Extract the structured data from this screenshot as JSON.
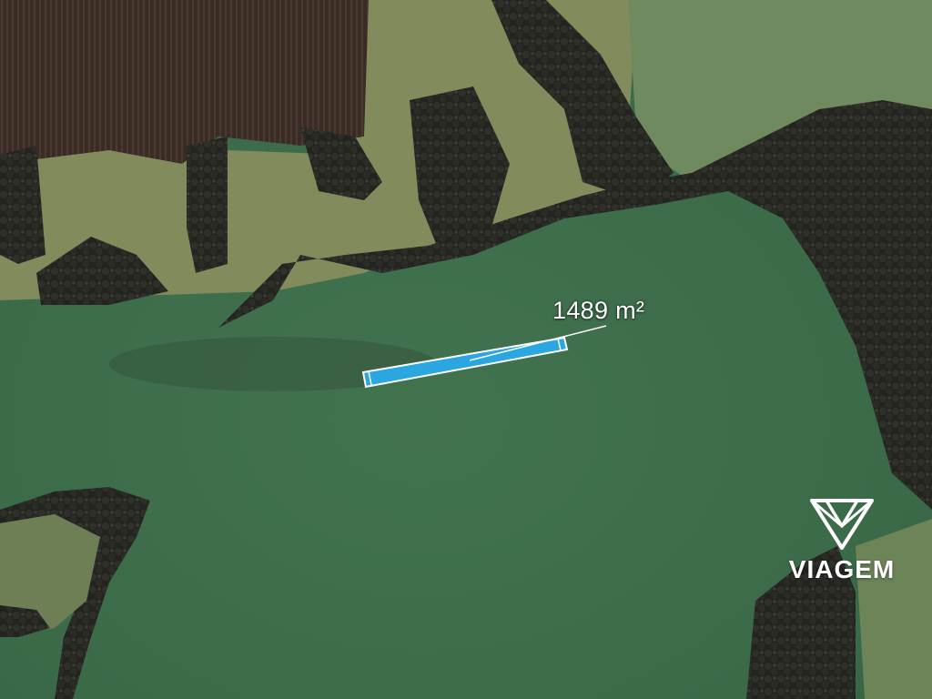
{
  "map": {
    "type": "satellite-aerial",
    "parcel": {
      "area_label": "1489 m²",
      "fill_color": "#2aa6e0",
      "outline_color": "#ffffff"
    },
    "watermark": {
      "brand": "VIAGEM",
      "icon": "diamond-logo-icon",
      "color": "#ffffff"
    },
    "terrain_colors": {
      "field": "#3f6f4c",
      "meadow": "#7d8a5a",
      "forest": "#2a2a26",
      "orchard": "#3d2e28"
    }
  }
}
